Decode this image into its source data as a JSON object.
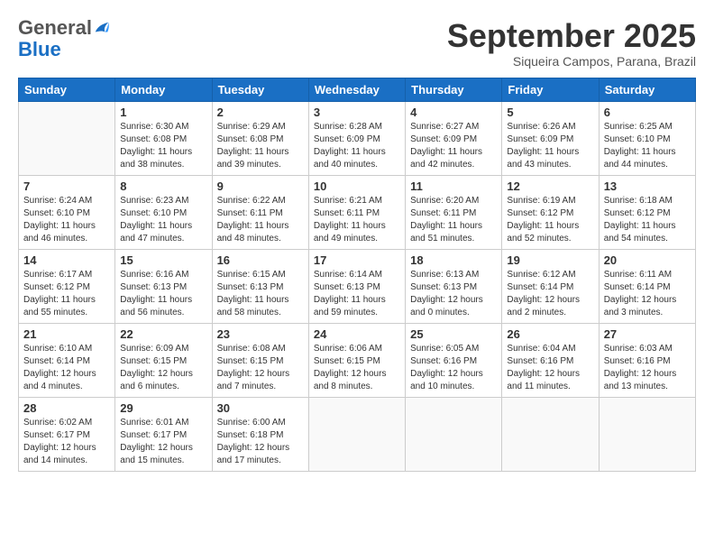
{
  "header": {
    "logo_general": "General",
    "logo_blue": "Blue",
    "title": "September 2025",
    "subtitle": "Siqueira Campos, Parana, Brazil"
  },
  "days_of_week": [
    "Sunday",
    "Monday",
    "Tuesday",
    "Wednesday",
    "Thursday",
    "Friday",
    "Saturday"
  ],
  "weeks": [
    [
      {
        "day": "",
        "info": ""
      },
      {
        "day": "1",
        "info": "Sunrise: 6:30 AM\nSunset: 6:08 PM\nDaylight: 11 hours\nand 38 minutes."
      },
      {
        "day": "2",
        "info": "Sunrise: 6:29 AM\nSunset: 6:08 PM\nDaylight: 11 hours\nand 39 minutes."
      },
      {
        "day": "3",
        "info": "Sunrise: 6:28 AM\nSunset: 6:09 PM\nDaylight: 11 hours\nand 40 minutes."
      },
      {
        "day": "4",
        "info": "Sunrise: 6:27 AM\nSunset: 6:09 PM\nDaylight: 11 hours\nand 42 minutes."
      },
      {
        "day": "5",
        "info": "Sunrise: 6:26 AM\nSunset: 6:09 PM\nDaylight: 11 hours\nand 43 minutes."
      },
      {
        "day": "6",
        "info": "Sunrise: 6:25 AM\nSunset: 6:10 PM\nDaylight: 11 hours\nand 44 minutes."
      }
    ],
    [
      {
        "day": "7",
        "info": "Sunrise: 6:24 AM\nSunset: 6:10 PM\nDaylight: 11 hours\nand 46 minutes."
      },
      {
        "day": "8",
        "info": "Sunrise: 6:23 AM\nSunset: 6:10 PM\nDaylight: 11 hours\nand 47 minutes."
      },
      {
        "day": "9",
        "info": "Sunrise: 6:22 AM\nSunset: 6:11 PM\nDaylight: 11 hours\nand 48 minutes."
      },
      {
        "day": "10",
        "info": "Sunrise: 6:21 AM\nSunset: 6:11 PM\nDaylight: 11 hours\nand 49 minutes."
      },
      {
        "day": "11",
        "info": "Sunrise: 6:20 AM\nSunset: 6:11 PM\nDaylight: 11 hours\nand 51 minutes."
      },
      {
        "day": "12",
        "info": "Sunrise: 6:19 AM\nSunset: 6:12 PM\nDaylight: 11 hours\nand 52 minutes."
      },
      {
        "day": "13",
        "info": "Sunrise: 6:18 AM\nSunset: 6:12 PM\nDaylight: 11 hours\nand 54 minutes."
      }
    ],
    [
      {
        "day": "14",
        "info": "Sunrise: 6:17 AM\nSunset: 6:12 PM\nDaylight: 11 hours\nand 55 minutes."
      },
      {
        "day": "15",
        "info": "Sunrise: 6:16 AM\nSunset: 6:13 PM\nDaylight: 11 hours\nand 56 minutes."
      },
      {
        "day": "16",
        "info": "Sunrise: 6:15 AM\nSunset: 6:13 PM\nDaylight: 11 hours\nand 58 minutes."
      },
      {
        "day": "17",
        "info": "Sunrise: 6:14 AM\nSunset: 6:13 PM\nDaylight: 11 hours\nand 59 minutes."
      },
      {
        "day": "18",
        "info": "Sunrise: 6:13 AM\nSunset: 6:13 PM\nDaylight: 12 hours\nand 0 minutes."
      },
      {
        "day": "19",
        "info": "Sunrise: 6:12 AM\nSunset: 6:14 PM\nDaylight: 12 hours\nand 2 minutes."
      },
      {
        "day": "20",
        "info": "Sunrise: 6:11 AM\nSunset: 6:14 PM\nDaylight: 12 hours\nand 3 minutes."
      }
    ],
    [
      {
        "day": "21",
        "info": "Sunrise: 6:10 AM\nSunset: 6:14 PM\nDaylight: 12 hours\nand 4 minutes."
      },
      {
        "day": "22",
        "info": "Sunrise: 6:09 AM\nSunset: 6:15 PM\nDaylight: 12 hours\nand 6 minutes."
      },
      {
        "day": "23",
        "info": "Sunrise: 6:08 AM\nSunset: 6:15 PM\nDaylight: 12 hours\nand 7 minutes."
      },
      {
        "day": "24",
        "info": "Sunrise: 6:06 AM\nSunset: 6:15 PM\nDaylight: 12 hours\nand 8 minutes."
      },
      {
        "day": "25",
        "info": "Sunrise: 6:05 AM\nSunset: 6:16 PM\nDaylight: 12 hours\nand 10 minutes."
      },
      {
        "day": "26",
        "info": "Sunrise: 6:04 AM\nSunset: 6:16 PM\nDaylight: 12 hours\nand 11 minutes."
      },
      {
        "day": "27",
        "info": "Sunrise: 6:03 AM\nSunset: 6:16 PM\nDaylight: 12 hours\nand 13 minutes."
      }
    ],
    [
      {
        "day": "28",
        "info": "Sunrise: 6:02 AM\nSunset: 6:17 PM\nDaylight: 12 hours\nand 14 minutes."
      },
      {
        "day": "29",
        "info": "Sunrise: 6:01 AM\nSunset: 6:17 PM\nDaylight: 12 hours\nand 15 minutes."
      },
      {
        "day": "30",
        "info": "Sunrise: 6:00 AM\nSunset: 6:18 PM\nDaylight: 12 hours\nand 17 minutes."
      },
      {
        "day": "",
        "info": ""
      },
      {
        "day": "",
        "info": ""
      },
      {
        "day": "",
        "info": ""
      },
      {
        "day": "",
        "info": ""
      }
    ]
  ]
}
